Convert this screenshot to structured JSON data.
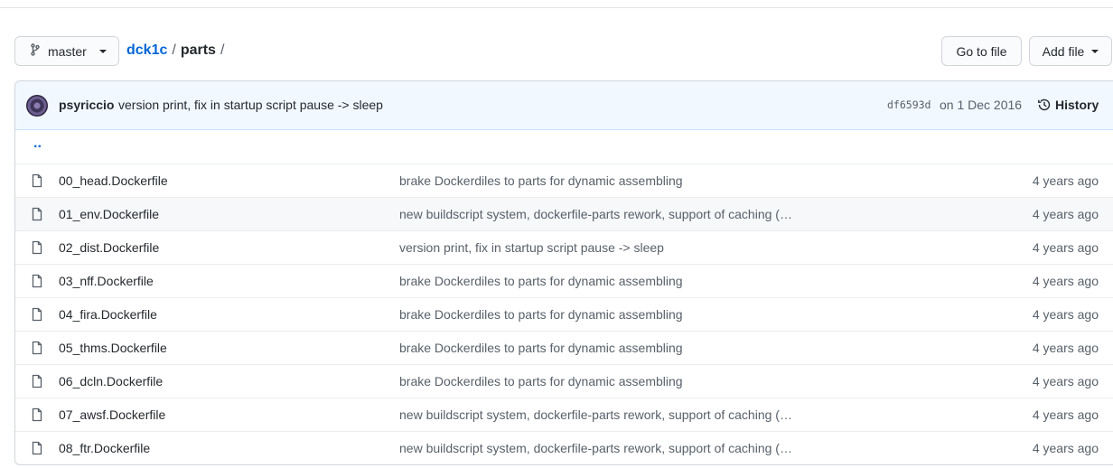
{
  "branch": {
    "name": "master"
  },
  "breadcrumb": {
    "repo": "dck1c",
    "separator": "/",
    "current": "parts",
    "trailing": "/"
  },
  "toolbar": {
    "goto_label": "Go to file",
    "add_label": "Add file"
  },
  "commit": {
    "author": "psyriccio",
    "message": "version print, fix in startup script pause -> sleep",
    "sha": "df6593d",
    "date": "on 1 Dec 2016",
    "history_label": "History"
  },
  "updir": "..",
  "files": [
    {
      "name": "00_head.Dockerfile",
      "message": "brake Dockerdiles to parts for dynamic assembling",
      "age": "4 years ago"
    },
    {
      "name": "01_env.Dockerfile",
      "message": "new buildscript system, dockerfile-parts rework, support of caching (…",
      "age": "4 years ago"
    },
    {
      "name": "02_dist.Dockerfile",
      "message": "version print, fix in startup script pause -> sleep",
      "age": "4 years ago"
    },
    {
      "name": "03_nff.Dockerfile",
      "message": "brake Dockerdiles to parts for dynamic assembling",
      "age": "4 years ago"
    },
    {
      "name": "04_fira.Dockerfile",
      "message": "brake Dockerdiles to parts for dynamic assembling",
      "age": "4 years ago"
    },
    {
      "name": "05_thms.Dockerfile",
      "message": "brake Dockerdiles to parts for dynamic assembling",
      "age": "4 years ago"
    },
    {
      "name": "06_dcln.Dockerfile",
      "message": "brake Dockerdiles to parts for dynamic assembling",
      "age": "4 years ago"
    },
    {
      "name": "07_awsf.Dockerfile",
      "message": "new buildscript system, dockerfile-parts rework, support of caching (…",
      "age": "4 years ago"
    },
    {
      "name": "08_ftr.Dockerfile",
      "message": "new buildscript system, dockerfile-parts rework, support of caching (…",
      "age": "4 years ago"
    }
  ],
  "colors": {
    "link": "#0366d6",
    "commit_bg": "#f1f8ff",
    "border": "#d1d5da",
    "muted": "#586069"
  },
  "icons": {
    "branch": "git-branch-icon",
    "file": "file-icon",
    "history": "history-icon"
  }
}
